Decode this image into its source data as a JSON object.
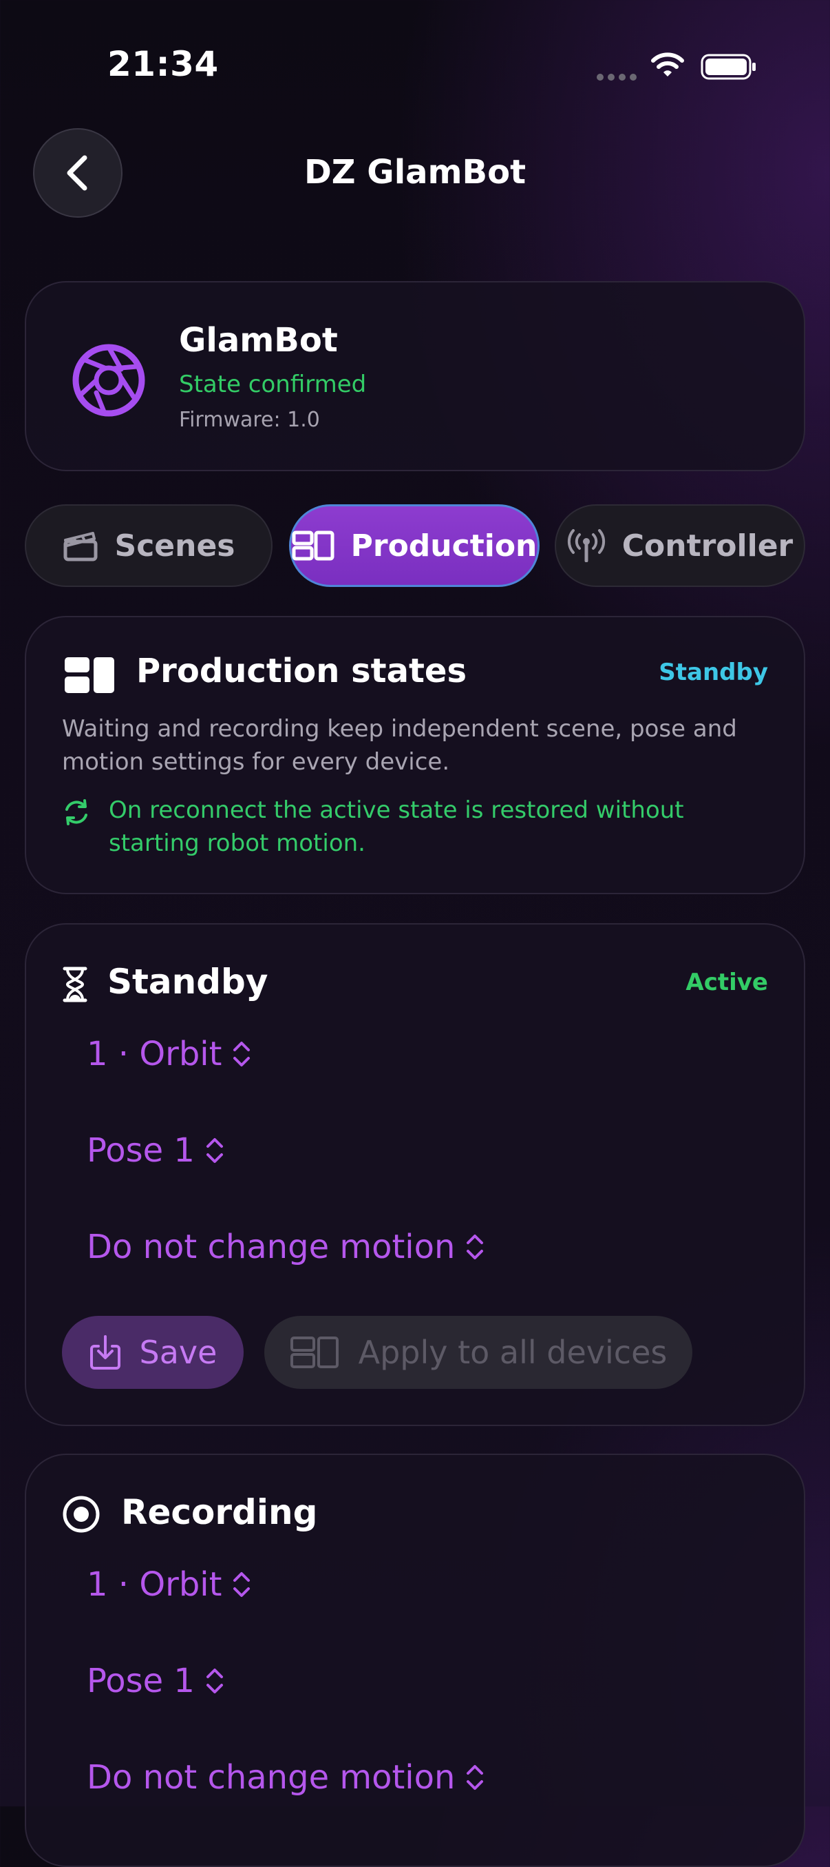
{
  "status_bar": {
    "time": "21:34"
  },
  "nav": {
    "title": "DZ GlamBot"
  },
  "device": {
    "name": "GlamBot",
    "state": "State confirmed",
    "firmware": "Firmware: 1.0"
  },
  "tabs": [
    {
      "label": "Scenes",
      "icon": "clapperboard-icon",
      "active": false
    },
    {
      "label": "Production",
      "icon": "layout-panels-icon",
      "active": true
    },
    {
      "label": "Controller",
      "icon": "antenna-icon",
      "active": false
    }
  ],
  "production_states": {
    "title": "Production states",
    "badge": "Standby",
    "description": "Waiting and recording keep independent scene, pose and motion settings for every device.",
    "note": "On reconnect the active state is restored without starting robot motion."
  },
  "standby": {
    "title": "Standby",
    "badge": "Active",
    "scene": "1 · Orbit",
    "pose": "Pose 1",
    "motion": "Do not change motion",
    "save_label": "Save",
    "apply_label": "Apply to all devices"
  },
  "recording": {
    "title": "Recording",
    "scene": "1 · Orbit",
    "pose": "Pose 1",
    "motion": "Do not change motion"
  },
  "colors": {
    "accent": "#b557ec",
    "success": "#33cc66",
    "info": "#3ec7e6",
    "active_tab": "#8d3ccf"
  }
}
